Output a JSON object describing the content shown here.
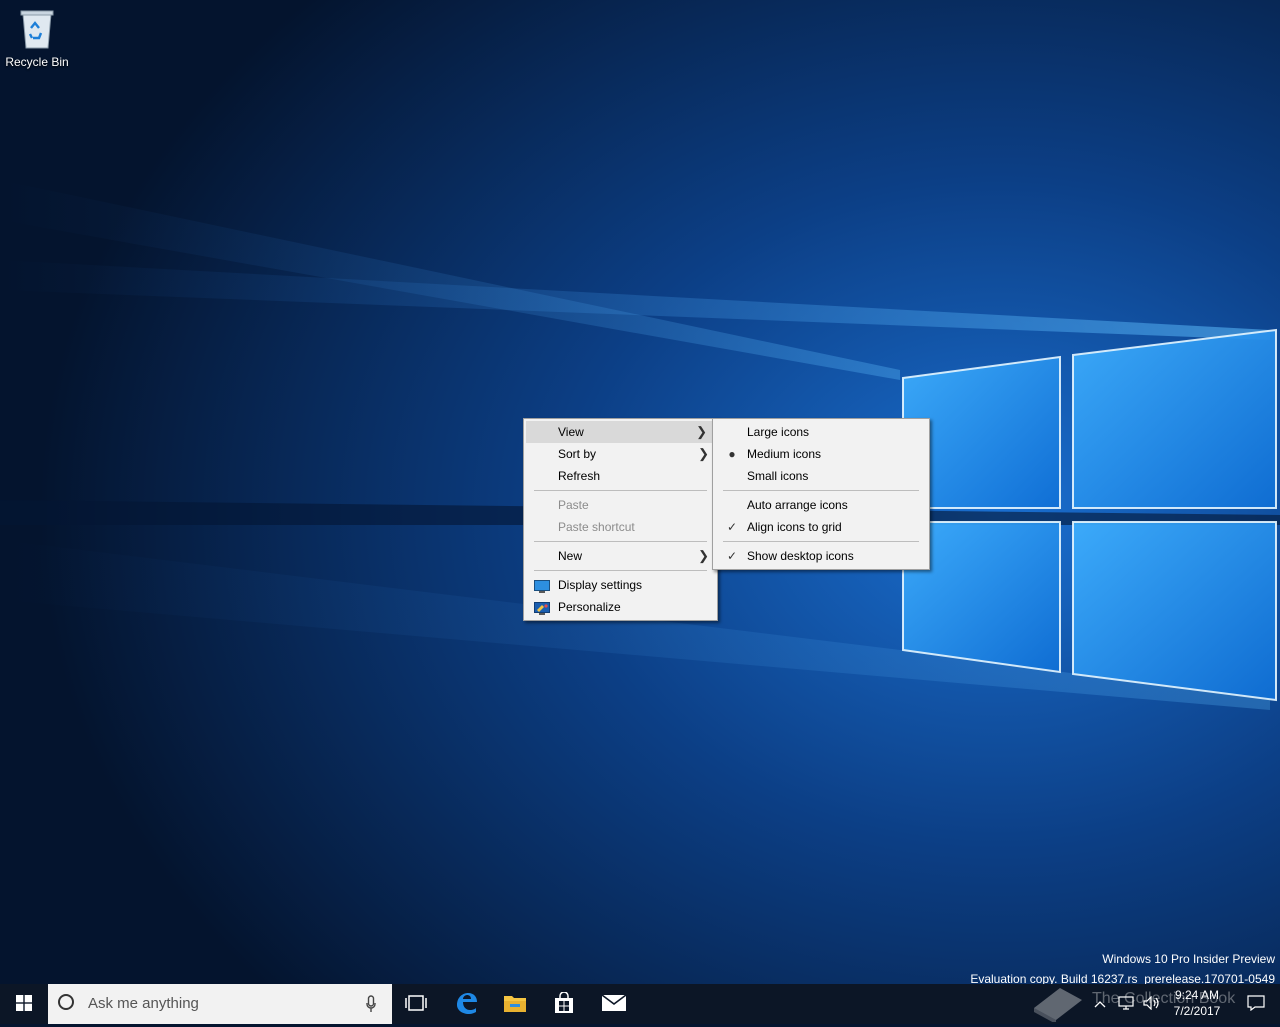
{
  "desktop": {
    "icons": [
      {
        "label": "Recycle Bin",
        "icon": "recycle-bin-icon"
      }
    ]
  },
  "context_menu": {
    "items": {
      "view": "View",
      "sort_by": "Sort by",
      "refresh": "Refresh",
      "paste": "Paste",
      "paste_shortcut": "Paste shortcut",
      "new": "New",
      "display_settings": "Display settings",
      "personalize": "Personalize"
    }
  },
  "view_submenu": {
    "items": {
      "large": "Large icons",
      "medium": "Medium icons",
      "small": "Small icons",
      "auto_arrange": "Auto arrange icons",
      "align_grid": "Align icons to grid",
      "show_desktop": "Show desktop icons"
    },
    "selected_size": "Medium icons",
    "checked": [
      "Align icons to grid",
      "Show desktop icons"
    ]
  },
  "watermark": {
    "line1": "Windows 10 Pro Insider Preview",
    "line2": "Evaluation copy. Build 16237.rs_prerelease.170701-0549"
  },
  "taskbar": {
    "search_placeholder": "Ask me anything",
    "pinned": [
      "task-view-icon",
      "edge-icon",
      "file-explorer-icon",
      "store-icon",
      "mail-icon"
    ],
    "clock": {
      "time": "9:24 AM",
      "date": "7/2/2017"
    }
  },
  "overlay": {
    "brand": "The Collection Book"
  },
  "colors": {
    "accent": "#0078d7",
    "menu_bg": "#f2f2f2",
    "taskbar_bg": "#0c1626"
  }
}
